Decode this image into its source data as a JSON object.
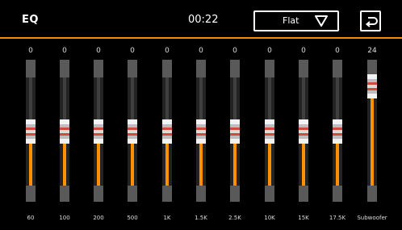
{
  "header": {
    "title": "EQ",
    "clock": "00:22",
    "preset": {
      "selected": "Flat"
    },
    "back_icon": "back-icon",
    "accent_color": "#ff8a00"
  },
  "bands": [
    {
      "freq": "60",
      "value": "0",
      "level": 0.5
    },
    {
      "freq": "100",
      "value": "0",
      "level": 0.5
    },
    {
      "freq": "200",
      "value": "0",
      "level": 0.5
    },
    {
      "freq": "500",
      "value": "0",
      "level": 0.5
    },
    {
      "freq": "1K",
      "value": "0",
      "level": 0.5
    },
    {
      "freq": "1.5K",
      "value": "0",
      "level": 0.5
    },
    {
      "freq": "2.5K",
      "value": "0",
      "level": 0.5
    },
    {
      "freq": "10K",
      "value": "0",
      "level": 0.5
    },
    {
      "freq": "15K",
      "value": "0",
      "level": 0.5
    },
    {
      "freq": "17.5K",
      "value": "0",
      "level": 0.5
    },
    {
      "freq": "Subwoofer",
      "value": "24",
      "level": 1.0
    }
  ]
}
